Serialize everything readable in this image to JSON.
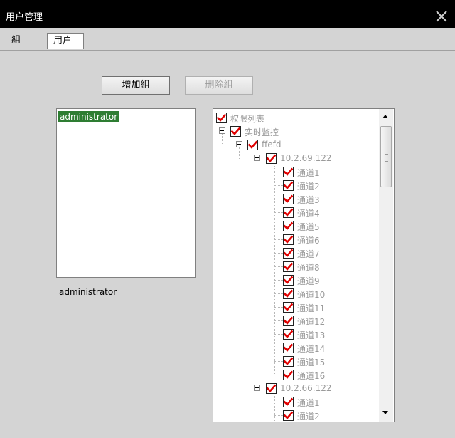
{
  "window": {
    "title": "用户管理",
    "close_icon": "close-icon"
  },
  "tabs": [
    {
      "label": "組"
    },
    {
      "label": "用户"
    }
  ],
  "toolbar": {
    "add_group_label": "增加組",
    "delete_group_label": "删除組"
  },
  "groups": {
    "items": [
      {
        "label": "administrator"
      }
    ],
    "selected_label": "administrator"
  },
  "permissions": {
    "root": "权限列表",
    "category": "实时监控",
    "node": "ffefd",
    "device1": "10.2.69.122",
    "device1_channels": [
      "通道1",
      "通道2",
      "通道3",
      "通道4",
      "通道5",
      "通道6",
      "通道7",
      "通道8",
      "通道9",
      "通道10",
      "通道11",
      "通道12",
      "通道13",
      "通道14",
      "通道15",
      "通道16"
    ],
    "device2": "10.2.66.122",
    "device2_channels": [
      "通道1",
      "通道2"
    ]
  },
  "colors": {
    "titlebar": "#000000",
    "selection": "#2e7d32",
    "check": "#e00000",
    "disabled_text": "#9a9a9a"
  }
}
